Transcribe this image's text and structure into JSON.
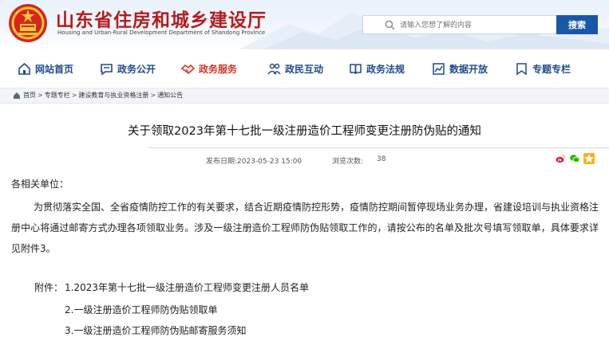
{
  "header": {
    "site_title": "山东省住房和城乡建设厅",
    "site_subtitle": "Housing and Urban-Rural Development Department of Shandong Province",
    "search_placeholder": "请输入您想了解的内容",
    "search_button": "搜索",
    "brand_color": "#b21d1d",
    "accent_color": "#1a57a5"
  },
  "nav": {
    "items": [
      {
        "label": "网站首页",
        "icon": "home-icon"
      },
      {
        "label": "政务公开",
        "icon": "chat-icon"
      },
      {
        "label": "政务服务",
        "icon": "handshake-icon",
        "active": true
      },
      {
        "label": "政民互动",
        "icon": "people-icon"
      },
      {
        "label": "政务法规",
        "icon": "book-icon"
      },
      {
        "label": "数据开放",
        "icon": "chart-icon"
      },
      {
        "label": "专题专栏",
        "icon": "feature-icon"
      }
    ]
  },
  "breadcrumb": [
    "首页",
    "专题专栏",
    "建设教育与执业资格注册",
    "通知公告"
  ],
  "article": {
    "title": "关于领取2023年第十七批一级注册造价工程师变更注册防伪贴的通知",
    "publish_label": "发布日期:2023-05-23 15:00",
    "views_label": "浏览次数:",
    "views_count": "38",
    "greeting": "各相关单位：",
    "paragraph": "为贯彻落实全国、全省疫情防控工作的有关要求，结合近期疫情防控形势，疫情防控期间暂停现场业务办理，省建设培训与执业资格注册中心将通过邮寄方式办理各项领取业务。涉及一级注册造价工程师防伪贴领取工作的，请按公布的名单及批次号填写领取单，具体要求详见附件3。",
    "attachments_label": "附件：",
    "attachments": [
      "1.2023年第十七批一级注册造价工程师变更注册人员名单",
      "2.一级注册造价工程师防伪贴领取单",
      "3.一级注册造价工程师防伪贴邮寄服务须知"
    ]
  },
  "share": [
    "weibo-icon",
    "wechat-icon",
    "qzone-icon"
  ]
}
